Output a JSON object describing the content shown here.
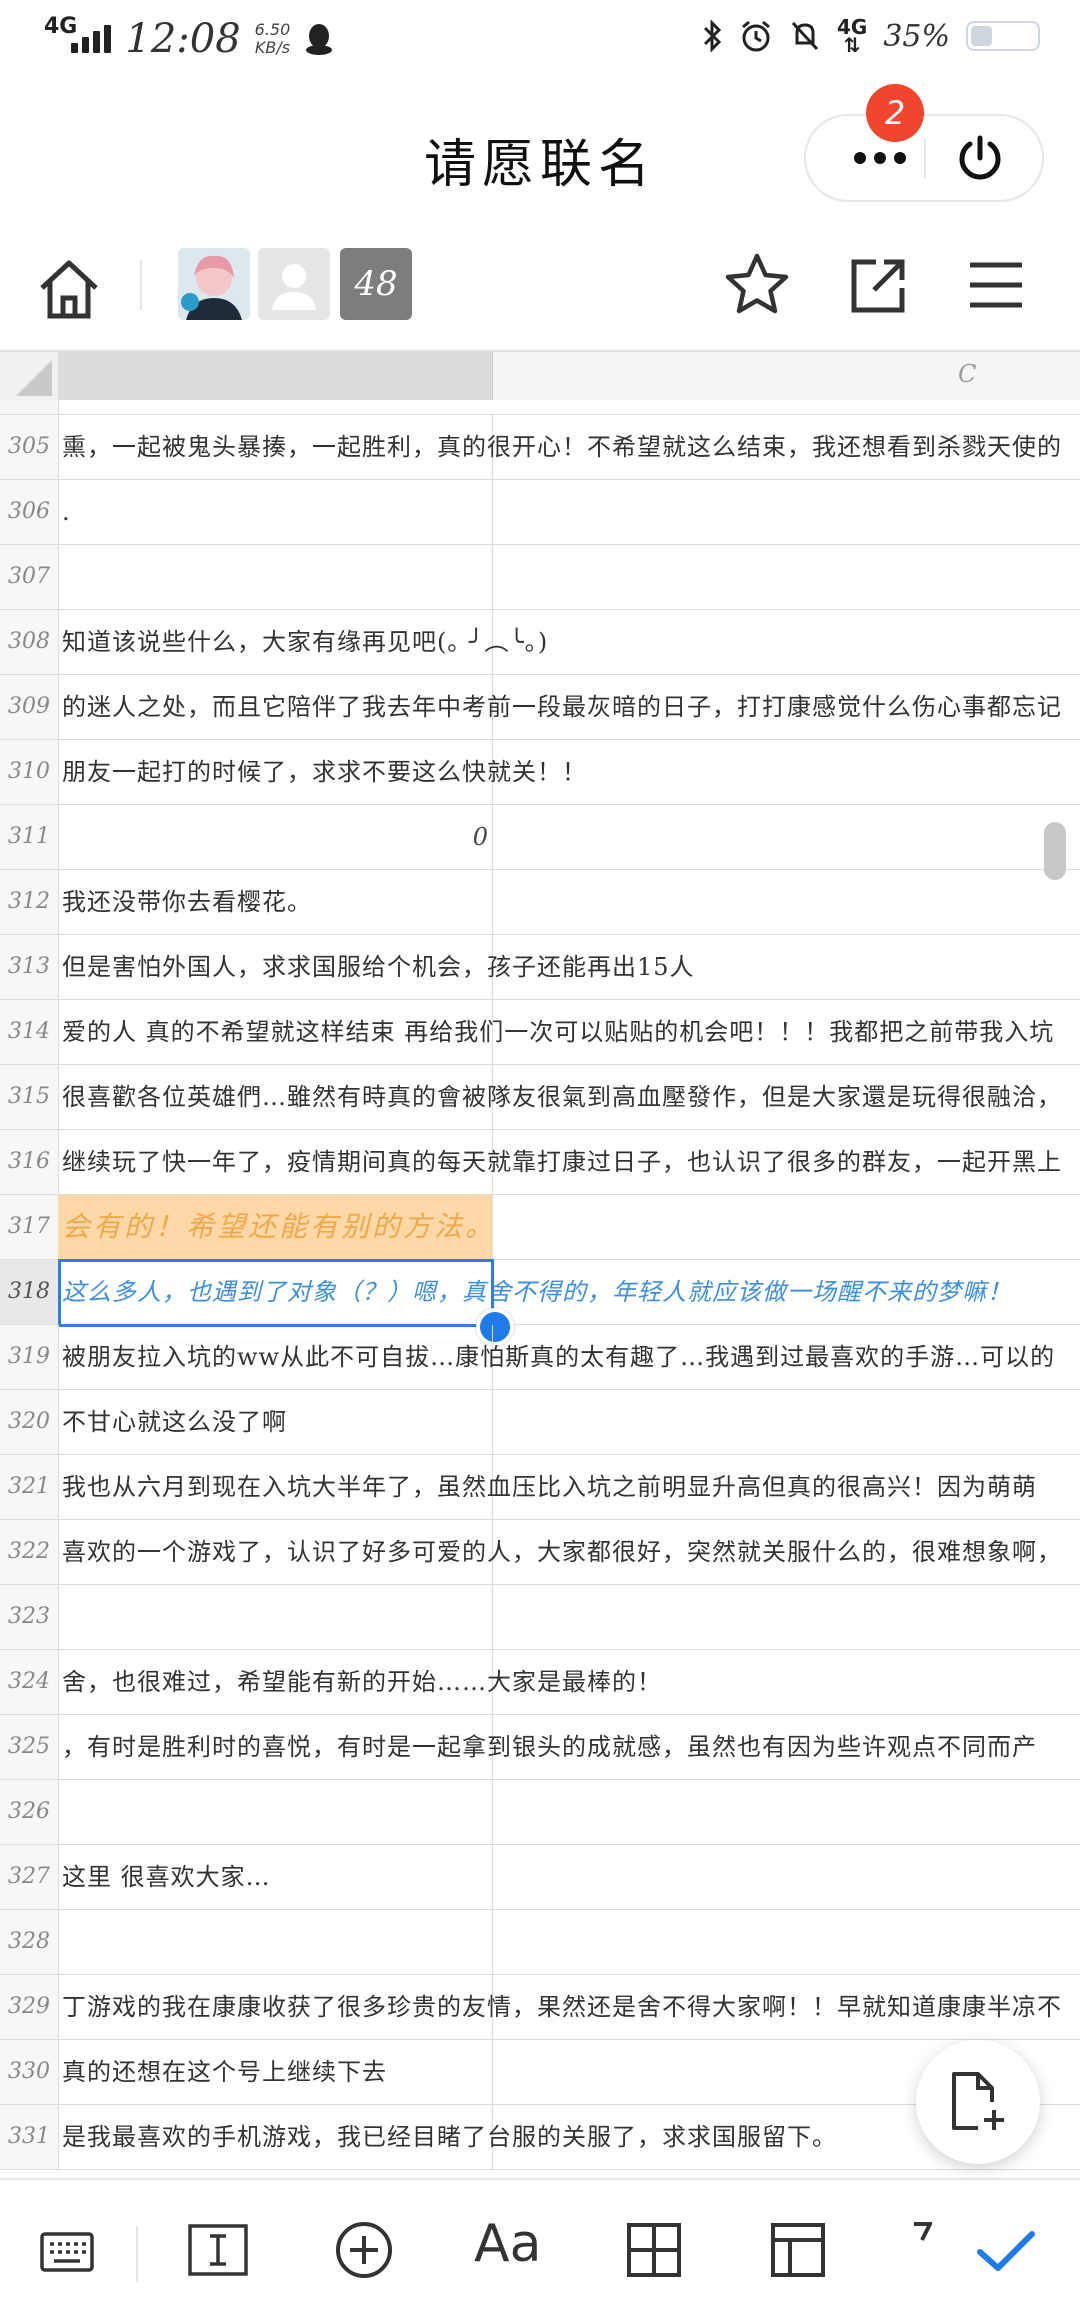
{
  "status_bar": {
    "network": "4G",
    "time": "12:08",
    "speed_value": "6.50",
    "speed_unit": "KB/s",
    "right_network": "4G",
    "battery": "35%",
    "battery_level": 0.35
  },
  "header": {
    "title": "请愿联名",
    "notification_badge": "2"
  },
  "toolbar": {
    "collaborator_count": "48"
  },
  "sheet": {
    "column_c_label": "C",
    "rows": [
      {
        "num": "305",
        "text": "熏，一起被鬼头暴揍，一起胜利，真的很开心！不希望就这么结束，我还想看到杀戮天使的"
      },
      {
        "num": "306",
        "text": "."
      },
      {
        "num": "307",
        "text": ""
      },
      {
        "num": "308",
        "text": "知道该说些什么，大家有缘再见吧(｡ ╯︵╰｡)"
      },
      {
        "num": "309",
        "text": "的迷人之处，而且它陪伴了我去年中考前一段最灰暗的日子，打打康感觉什么伤心事都忘记"
      },
      {
        "num": "310",
        "text": "朋友一起打的时候了，求求不要这么快就关！！"
      },
      {
        "num": "311",
        "text": "",
        "value": "0"
      },
      {
        "num": "312",
        "text": " 我还没带你去看樱花。"
      },
      {
        "num": "313",
        "text": "但是害怕外国人，求求国服给个机会，孩子还能再出15人"
      },
      {
        "num": "314",
        "text": "爱的人 真的不希望就这样结束 再给我们一次可以贴贴的机会吧！！！我都把之前带我入坑"
      },
      {
        "num": "315",
        "text": "很喜歡各位英雄們…雖然有時真的會被隊友很氣到高血壓發作，但是大家還是玩得很融洽，"
      },
      {
        "num": "316",
        "text": "继续玩了快一年了，疫情期间真的每天就靠打康过日子，也认识了很多的群友，一起开黑上"
      },
      {
        "num": "317",
        "text": "会有的！希望还能有别的方法。",
        "style": "highlight"
      },
      {
        "num": "318",
        "text": "这么多人，也遇到了对象（？）嗯，真舍不得的，年轻人就应该做一场醒不来的梦嘛！",
        "style": "selected"
      },
      {
        "num": "319",
        "text": "被朋友拉入坑的ww从此不可自拔…康怕斯真的太有趣了…我遇到过最喜欢的手游…可以的"
      },
      {
        "num": "320",
        "text": "不甘心就这么没了啊"
      },
      {
        "num": "321",
        "text": "我也从六月到现在入坑大半年了，虽然血压比入坑之前明显升高但真的很高兴！因为萌萌"
      },
      {
        "num": "322",
        "text": "喜欢的一个游戏了，认识了好多可爱的人，大家都很好，突然就关服什么的，很难想象啊，"
      },
      {
        "num": "323",
        "text": ""
      },
      {
        "num": "324",
        "text": "舍，也很难过，希望能有新的开始……大家是最棒的！"
      },
      {
        "num": "325",
        "text": "，有时是胜利时的喜悦，有时是一起拿到银头的成就感，虽然也有因为些许观点不同而产"
      },
      {
        "num": "326",
        "text": ""
      },
      {
        "num": "327",
        "text": "这里 很喜欢大家…"
      },
      {
        "num": "328",
        "text": ""
      },
      {
        "num": "329",
        "text": "丁游戏的我在康康收获了很多珍贵的友情，果然还是舍不得大家啊！！早就知道康康半凉不"
      },
      {
        "num": "330",
        "text": " 真的还想在这个号上继续下去"
      },
      {
        "num": "331",
        "text": "是我最喜欢的手机游戏，我已经目睹了台服的关服了，求求国服留下。"
      }
    ]
  },
  "bottom_bar": {
    "font_label": "Aa"
  },
  "colors": {
    "accent": "#1f7be8",
    "highlight_fill": "#fcd8a8",
    "highlight_text": "#f0a84a",
    "badge": "#f0462e"
  }
}
